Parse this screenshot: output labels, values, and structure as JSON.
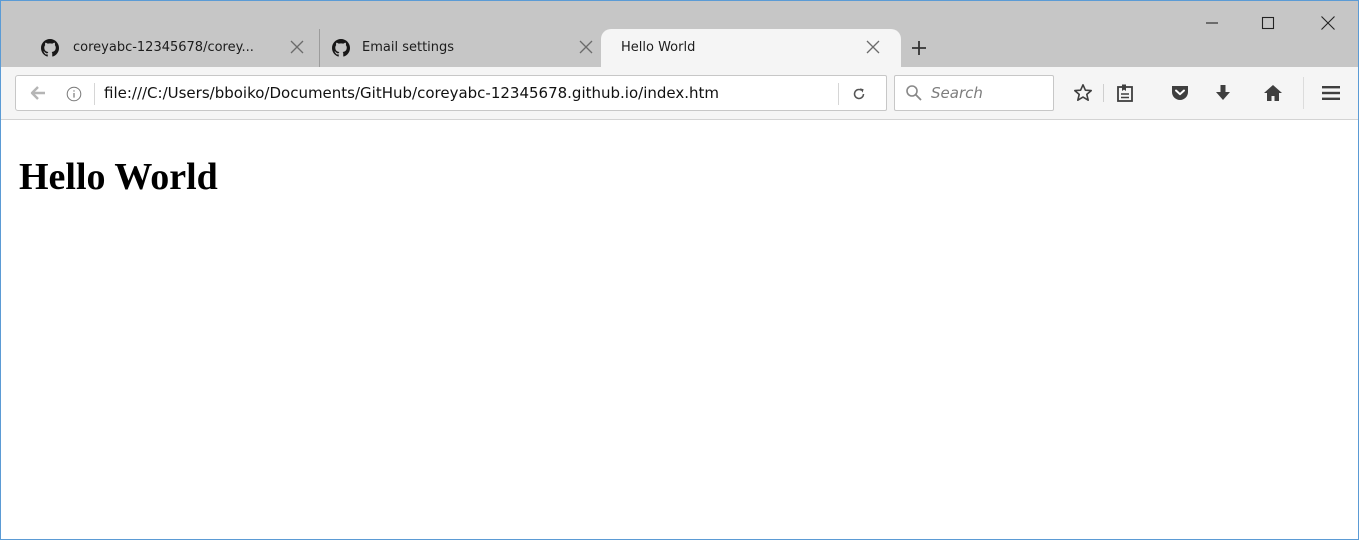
{
  "tabs": [
    {
      "title": "coreyabc-12345678/corey...",
      "icon": "github-icon",
      "active": false
    },
    {
      "title": "Email settings",
      "icon": "github-icon",
      "active": false
    },
    {
      "title": "Hello World",
      "icon": "",
      "active": true
    }
  ],
  "navbar": {
    "url": "file:///C:/Users/bboiko/Documents/GitHub/coreyabc-12345678.github.io/index.htm",
    "search_placeholder": "Search"
  },
  "page": {
    "heading": "Hello World"
  },
  "colors": {
    "tabstrip": "#c6c6c6",
    "active_tab": "#f5f5f5",
    "toolbar_icon": "#3f3f3f",
    "window_border": "#5b9bd5"
  }
}
